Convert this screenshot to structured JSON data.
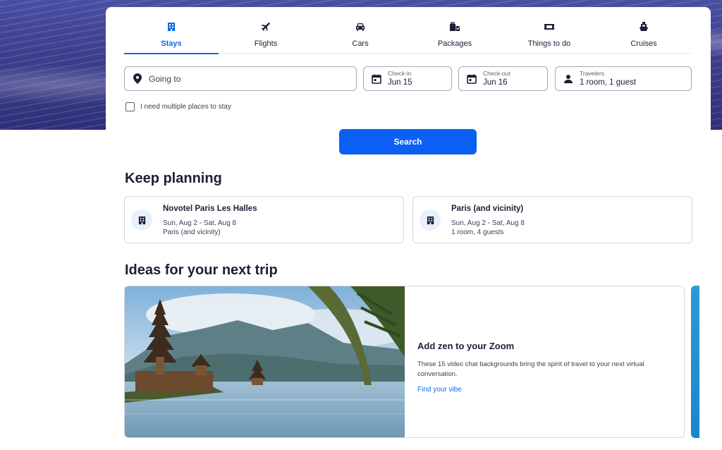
{
  "tabs": [
    {
      "label": "Stays",
      "icon": "building-icon",
      "active": true
    },
    {
      "label": "Flights",
      "icon": "airplane-icon"
    },
    {
      "label": "Cars",
      "icon": "car-icon"
    },
    {
      "label": "Packages",
      "icon": "packages-icon"
    },
    {
      "label": "Things to do",
      "icon": "ticket-icon"
    },
    {
      "label": "Cruises",
      "icon": "ship-icon"
    }
  ],
  "search": {
    "destination_placeholder": "Going to",
    "checkin_label": "Check-in",
    "checkin_value": "Jun 15",
    "checkout_label": "Check-out",
    "checkout_value": "Jun 16",
    "travelers_label": "Travelers",
    "travelers_value": "1 room, 1 guest",
    "multi_place_label": "I need multiple places to stay",
    "button_label": "Search"
  },
  "keep_planning": {
    "title": "Keep planning",
    "cards": [
      {
        "title": "Novotel Paris Les Halles",
        "line1": "Sun, Aug 2 - Sat, Aug 8",
        "line2": "Paris (and vicinity)"
      },
      {
        "title": "Paris (and vicinity)",
        "line1": "Sun, Aug 2 - Sat, Aug 8",
        "line2": "1 room, 4 guests"
      }
    ]
  },
  "ideas": {
    "title": "Ideas for your next trip",
    "card": {
      "title": "Add zen to your Zoom",
      "description": "These 15 video chat backgrounds bring the spirit of travel to your next virtual conversation.",
      "link": "Find your vibe"
    }
  },
  "colors": {
    "accent": "#1668e3",
    "button": "#0b5ff2",
    "text": "#1a1f36"
  }
}
